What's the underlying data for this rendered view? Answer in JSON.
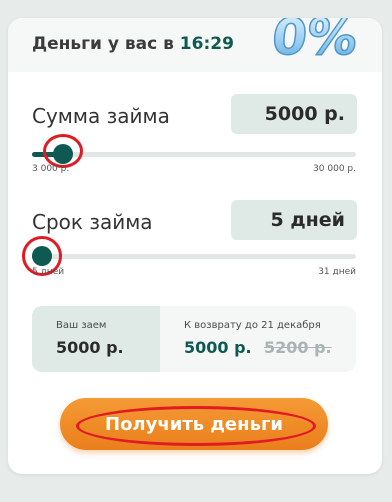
{
  "header": {
    "title_prefix": "Деньги у вас в",
    "time": "16:29",
    "promo_badge": "0%"
  },
  "amount": {
    "label": "Сумма займа",
    "value": "5000 р.",
    "min_label": "3 000 р.",
    "max_label": "30 000 р.",
    "slider_fraction": 0.07
  },
  "term": {
    "label": "Срок займа",
    "value": "5 дней",
    "min_label": "5 дней",
    "max_label": "31 дней",
    "slider_fraction": 0.0
  },
  "summary": {
    "loan_label": "Ваш заем",
    "loan_value": "5000 р.",
    "return_label": "К возврату до 21 декабря",
    "return_value": "5000 р.",
    "return_old_value": "5200 р."
  },
  "cta": {
    "label": "Получить деньги"
  },
  "colors": {
    "primary": "#0e5a52",
    "accent_orange": "#ea7f1c",
    "highlight_red": "#e01b24",
    "value_box": "#dfe9e6"
  }
}
